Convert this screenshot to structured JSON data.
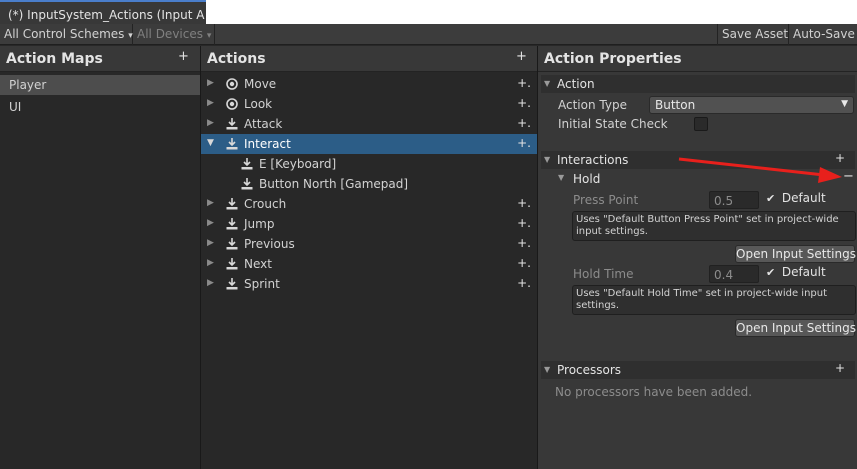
{
  "window": {
    "tab_title": "(*) InputSystem_Actions (Input A"
  },
  "toolbar": {
    "control_schemes": "All Control Schemes",
    "devices": "All Devices",
    "save_asset": "Save Asset",
    "auto_save": "Auto-Save"
  },
  "action_maps": {
    "title": "Action Maps",
    "add": "+",
    "items": [
      {
        "label": "Player",
        "selected": true
      },
      {
        "label": "UI",
        "selected": false
      }
    ]
  },
  "actions": {
    "title": "Actions",
    "add": "+",
    "rows": [
      {
        "label": "Move",
        "icon": "value-circle-icon"
      },
      {
        "label": "Look",
        "icon": "value-circle-icon"
      },
      {
        "label": "Attack",
        "icon": "button-action-icon"
      },
      {
        "label": "Interact",
        "icon": "button-action-icon",
        "selected": true,
        "expanded": true
      },
      {
        "label": "E [Keyboard]",
        "icon": "binding-icon",
        "child": true
      },
      {
        "label": "Button North [Gamepad]",
        "icon": "binding-icon",
        "child": true
      },
      {
        "label": "Crouch",
        "icon": "button-action-icon"
      },
      {
        "label": "Jump",
        "icon": "button-action-icon"
      },
      {
        "label": "Previous",
        "icon": "button-action-icon"
      },
      {
        "label": "Next",
        "icon": "button-action-icon"
      },
      {
        "label": "Sprint",
        "icon": "button-action-icon"
      }
    ]
  },
  "properties": {
    "title": "Action Properties",
    "action_section": "Action",
    "action_type_label": "Action Type",
    "action_type_value": "Button",
    "initial_state_label": "Initial State Check",
    "interactions_section": "Interactions",
    "interactions_add": "+",
    "hold": {
      "title": "Hold",
      "remove": "−",
      "press_point_label": "Press Point",
      "press_point_value": "0.5",
      "press_default_label": "Default",
      "press_help": "Uses \"Default Button Press Point\" set in project-wide input settings.",
      "open_settings_1": "Open Input Settings",
      "hold_time_label": "Hold Time",
      "hold_time_value": "0.4",
      "hold_default_label": "Default",
      "hold_help": "Uses \"Default Hold Time\" set in project-wide input settings.",
      "open_settings_2": "Open Input Settings"
    },
    "processors_section": "Processors",
    "processors_add": "+",
    "processors_empty": "No processors have been added."
  },
  "colors": {
    "selection": "#2c5d87",
    "annotation_arrow": "#e8201c"
  }
}
